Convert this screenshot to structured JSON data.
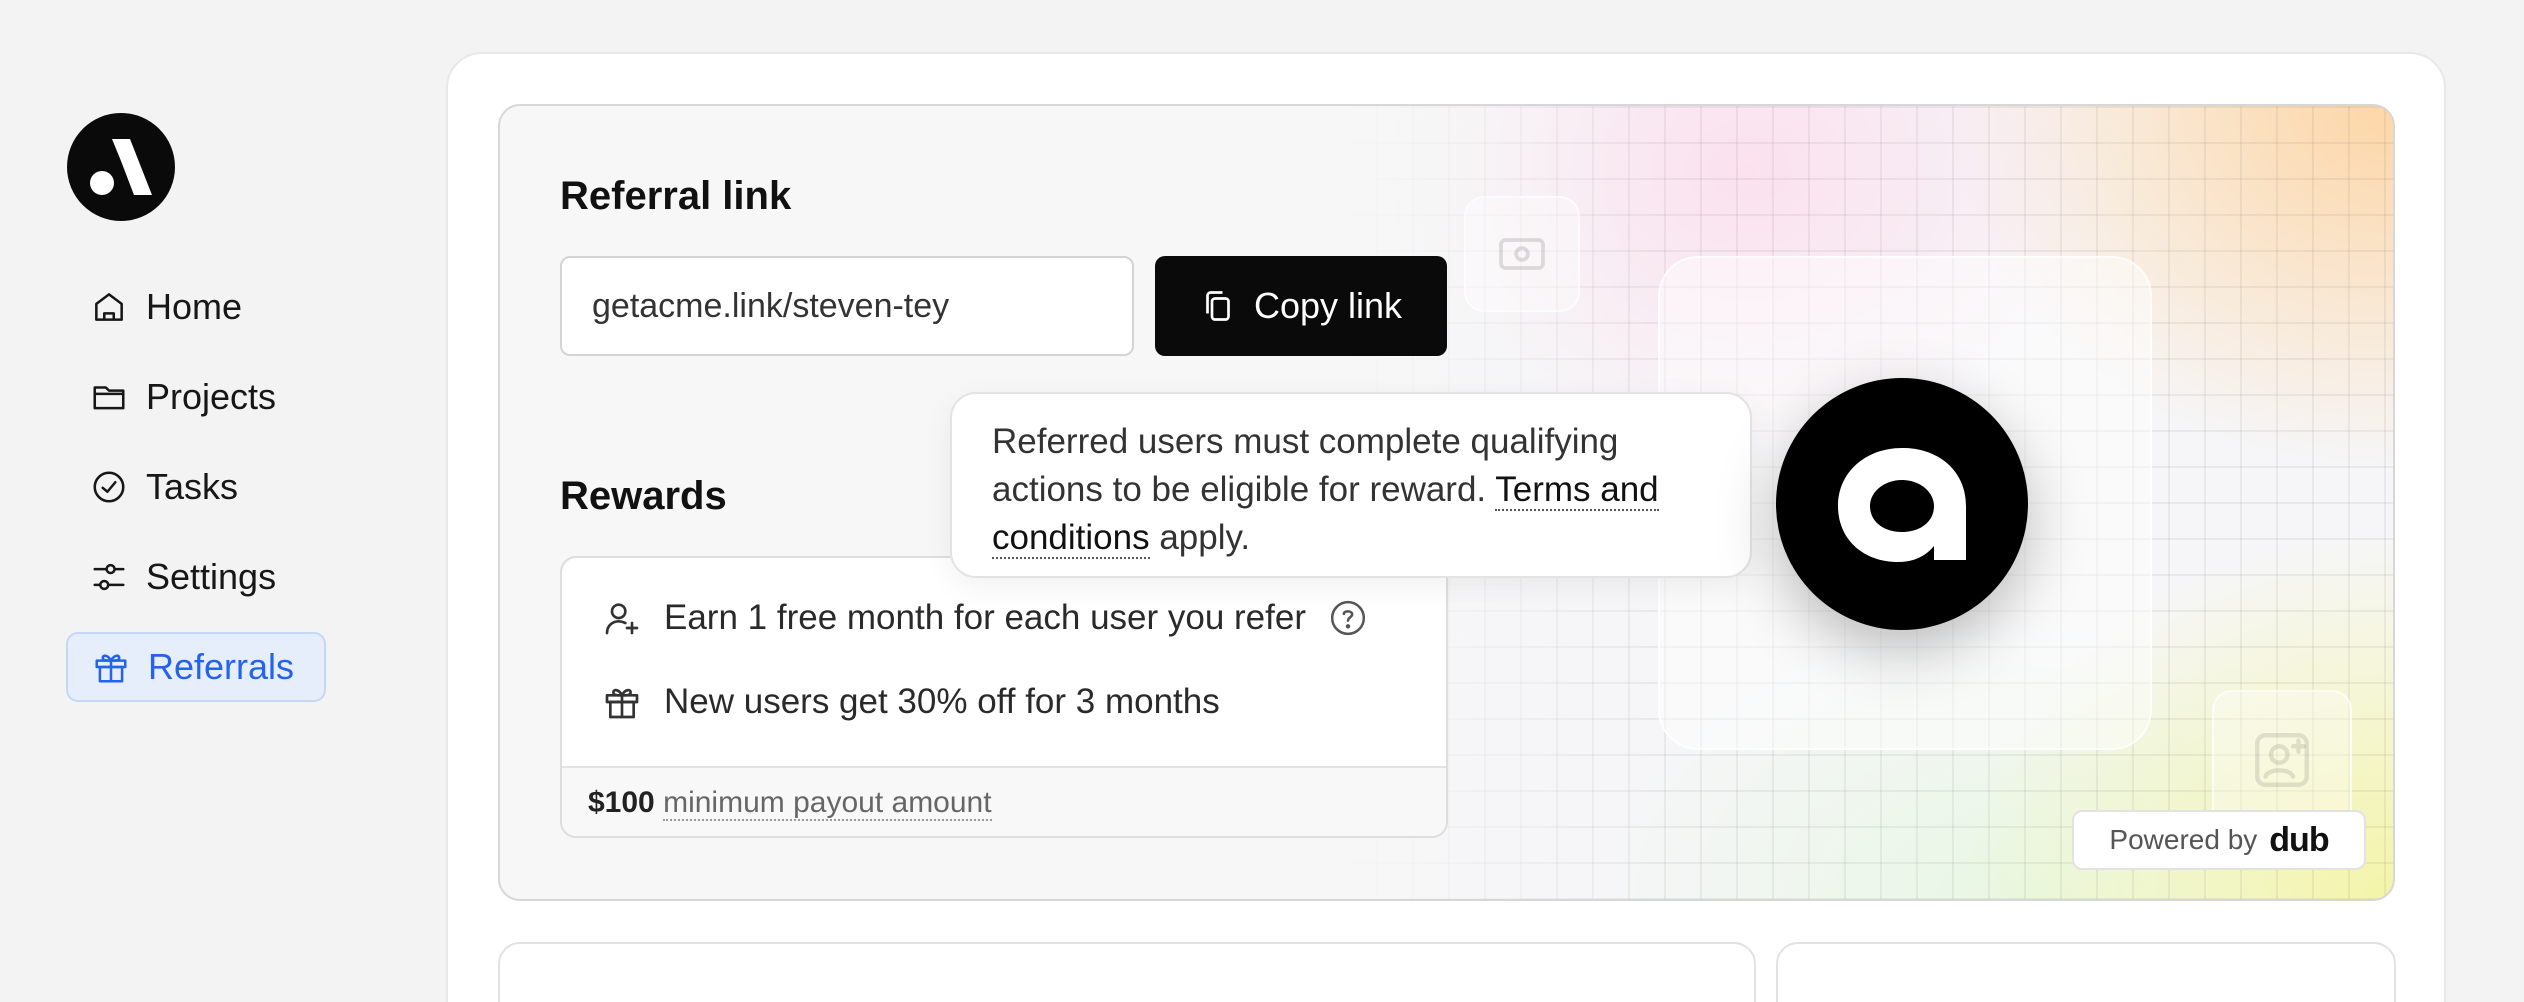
{
  "sidebar": {
    "logo_icon": "acme-logo-icon",
    "items": [
      {
        "label": "Home",
        "icon": "home-icon"
      },
      {
        "label": "Projects",
        "icon": "folder-icon"
      },
      {
        "label": "Tasks",
        "icon": "check-circle-icon"
      },
      {
        "label": "Settings",
        "icon": "sliders-icon"
      },
      {
        "label": "Referrals",
        "icon": "gift-icon",
        "active": true
      }
    ]
  },
  "referral": {
    "title": "Referral link",
    "link_value": "getacme.link/steven-tey",
    "copy_label": "Copy link"
  },
  "rewards": {
    "title": "Rewards",
    "items": [
      {
        "text": "Earn 1 free month for each user you refer",
        "icon": "user-plus-icon",
        "help": true
      },
      {
        "text": "New users get 30% off for 3 months",
        "icon": "gift-icon"
      }
    ],
    "payout_amount": "$100",
    "payout_label": "minimum payout amount"
  },
  "tooltip": {
    "text_before": "Referred users must complete qualifying actions to be eligible for reward. ",
    "link": "Terms and conditions",
    "text_after": " apply."
  },
  "powered": {
    "label": "Powered by",
    "brand": "dub"
  },
  "colors": {
    "accent": "#2563eb",
    "active_bg": "#e6eefc",
    "button_bg": "#0a0a0a"
  }
}
